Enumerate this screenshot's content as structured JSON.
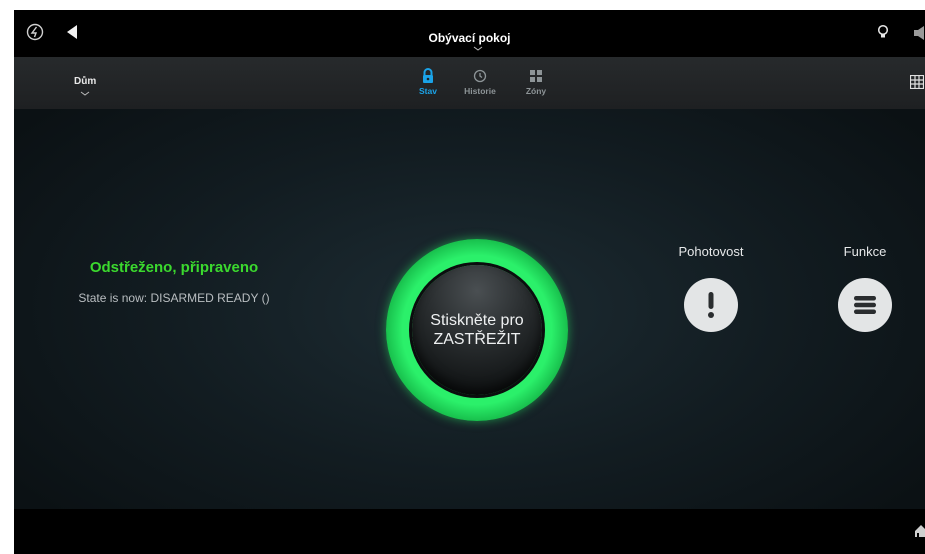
{
  "header": {
    "title": "Obývací pokoj"
  },
  "subnav": {
    "location": "Dům",
    "tabs": [
      {
        "label": "Stav",
        "icon": "lock-icon",
        "active": true
      },
      {
        "label": "Historie",
        "icon": "history-icon",
        "active": false
      },
      {
        "label": "Zóny",
        "icon": "zones-grid-icon",
        "active": false
      }
    ]
  },
  "main": {
    "status_text": "Odstřeženo, připraveno",
    "state_text": "State is now: DISARMED READY ()",
    "arm_button": {
      "line1": "Stiskněte pro",
      "line2": "ZASTŘEŽIT"
    },
    "actions": [
      {
        "label": "Pohotovost",
        "icon": "exclamation-icon"
      },
      {
        "label": "Funkce",
        "icon": "menu-icon"
      }
    ]
  },
  "colors": {
    "status_green": "#3bd92e",
    "active_tab_blue": "#1aa3e8",
    "ring_green": "#2bf06a"
  }
}
